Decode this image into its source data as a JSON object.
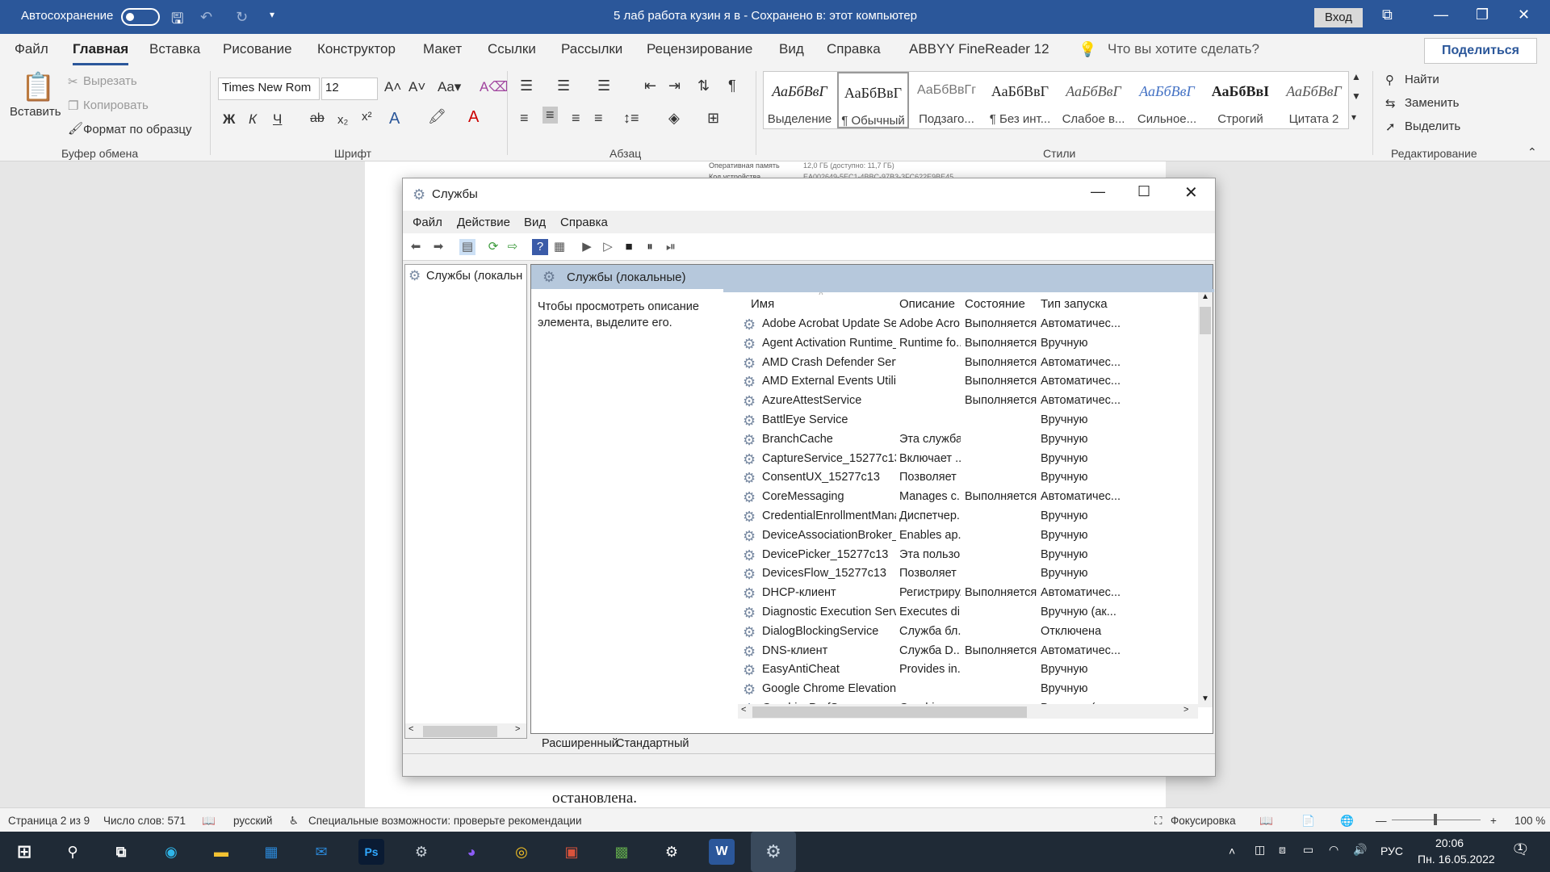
{
  "word": {
    "autosave": "Автосохранение",
    "title": "5 лаб работа кузин я в  -  Сохранено в: этот компьютер",
    "login": "Вход",
    "tabs": [
      "Файл",
      "Главная",
      "Вставка",
      "Рисование",
      "Конструктор",
      "Макет",
      "Ссылки",
      "Рассылки",
      "Рецензирование",
      "Вид",
      "Справка",
      "ABBYY FineReader 12"
    ],
    "tell": "Что вы хотите сделать?",
    "share": "Поделиться",
    "paste": "Вставить",
    "cut": "Вырезать",
    "copy": "Копировать",
    "format_painter": "Формат по образцу",
    "font": "Times New Rom",
    "size": "12",
    "bold": "Ж",
    "italic": "К",
    "underline": "Ч",
    "styles": [
      {
        "s": "АаБбВвГ",
        "n": "Выделение"
      },
      {
        "s": "АаБбВвГ",
        "n": "¶ Обычный"
      },
      {
        "s": "АаБбВвГг",
        "n": "Подзаго..."
      },
      {
        "s": "АаБбВвГ",
        "n": "¶ Без инт..."
      },
      {
        "s": "АаБбВвГ",
        "n": "Слабое в..."
      },
      {
        "s": "АаБбВвГ",
        "n": "Сильное..."
      },
      {
        "s": "АаБбВвІ",
        "n": "Строгий"
      },
      {
        "s": "АаБбВвГ",
        "n": "Цитата 2"
      }
    ],
    "find": "Найти",
    "replace": "Заменить",
    "select": "Выделить",
    "groups": [
      "Буфер обмена",
      "Шрифт",
      "Абзац",
      "Стили",
      "Редактирование"
    ],
    "doc_small1": "Оперативная память",
    "doc_small2": "Код устройства",
    "doc_val1": "12,0 ГБ (доступно: 11,7 ГБ)",
    "doc_val2": "EA002649-5EC1-4BBC-97B3-3FC622E9BE45",
    "doc_text": "остановлена."
  },
  "services": {
    "title": "Службы",
    "menu": [
      "Файл",
      "Действие",
      "Вид",
      "Справка"
    ],
    "tree_item": "Службы (локальн",
    "header": "Службы (локальные)",
    "description": "Чтобы просмотреть описание элемента, выделите его.",
    "columns": [
      "Имя",
      "Описание",
      "Состояние",
      "Тип запуска"
    ],
    "rows": [
      [
        "Adobe Acrobat Update Servi...",
        "Adobe Acro...",
        "Выполняется",
        "Автоматичес..."
      ],
      [
        "Agent Activation Runtime_1...",
        "Runtime fo...",
        "Выполняется",
        "Вручную"
      ],
      [
        "AMD Crash Defender Service",
        "",
        "Выполняется",
        "Автоматичес..."
      ],
      [
        "AMD External Events Utility",
        "",
        "Выполняется",
        "Автоматичес..."
      ],
      [
        "AzureAttestService",
        "",
        "Выполняется",
        "Автоматичес..."
      ],
      [
        "BattlEye Service",
        "",
        "",
        "Вручную"
      ],
      [
        "BranchCache",
        "Эта служба...",
        "",
        "Вручную"
      ],
      [
        "CaptureService_15277c13",
        "Включает ...",
        "",
        "Вручную"
      ],
      [
        "ConsentUX_15277c13",
        "Позволяет ...",
        "",
        "Вручную"
      ],
      [
        "CoreMessaging",
        "Manages c...",
        "Выполняется",
        "Автоматичес..."
      ],
      [
        "CredentialEnrollmentManag...",
        "Диспетчер...",
        "",
        "Вручную"
      ],
      [
        "DeviceAssociationBroker_15...",
        "Enables ap...",
        "",
        "Вручную"
      ],
      [
        "DevicePicker_15277c13",
        "Эта пользо...",
        "",
        "Вручную"
      ],
      [
        "DevicesFlow_15277c13",
        "Позволяет ...",
        "",
        "Вручную"
      ],
      [
        "DHCP-клиент",
        "Регистриру...",
        "Выполняется",
        "Автоматичес..."
      ],
      [
        "Diagnostic Execution Service",
        "Executes di...",
        "",
        "Вручную (ак..."
      ],
      [
        "DialogBlockingService",
        "Служба бл...",
        "",
        "Отключена"
      ],
      [
        "DNS-клиент",
        "Служба D...",
        "Выполняется",
        "Автоматичес..."
      ],
      [
        "EasyAntiCheat",
        "Provides in...",
        "",
        "Вручную"
      ],
      [
        "Google Chrome Elevation Se...",
        "",
        "",
        "Вручную"
      ],
      [
        "GraphicsPerfSvc",
        "Graphics p...",
        "",
        "Вручную (ак..."
      ]
    ],
    "bottom_tabs": [
      "Расширенный",
      "Стандартный"
    ]
  },
  "status": {
    "page": "Страница 2 из 9",
    "words": "Число слов: 571",
    "lang": "русский",
    "access": "Специальные возможности: проверьте рекомендации",
    "focus": "Фокусировка",
    "zoom": "100 %"
  },
  "taskbar": {
    "lang": "РУС",
    "time": "20:06",
    "date": "Пн. 16.05.2022",
    "notif": "1"
  }
}
